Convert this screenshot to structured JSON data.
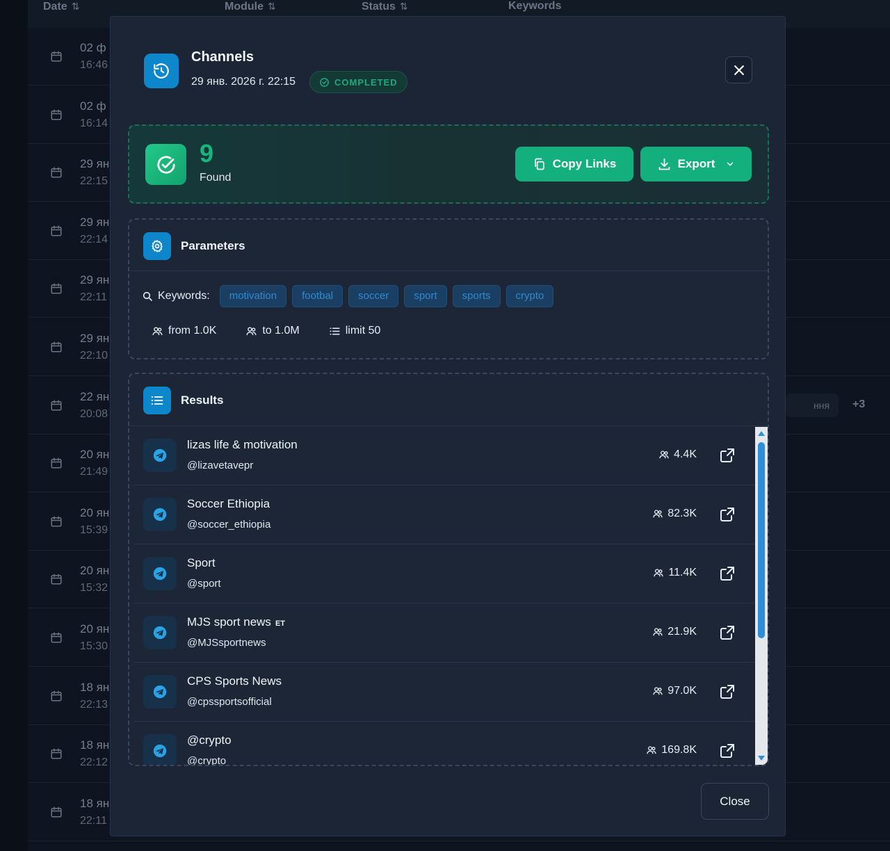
{
  "background": {
    "columns": [
      "Date",
      "Module",
      "Status",
      "Keywords"
    ],
    "rows": [
      {
        "date": "02 ф",
        "time": "16:46"
      },
      {
        "date": "02 ф",
        "time": "16:14"
      },
      {
        "date": "29 ян",
        "time": "22:15"
      },
      {
        "date": "29 ян",
        "time": "22:14"
      },
      {
        "date": "29 ян",
        "time": "22:11"
      },
      {
        "date": "29 ян",
        "time": "22:10"
      },
      {
        "date": "22 ян",
        "time": "20:08"
      },
      {
        "date": "20 ян",
        "time": "21:49"
      },
      {
        "date": "20 ян",
        "time": "15:39"
      },
      {
        "date": "20 ян",
        "time": "15:32"
      },
      {
        "date": "20 ян",
        "time": "15:30"
      },
      {
        "date": "18 ян",
        "time": "22:13"
      },
      {
        "date": "18 ян",
        "time": "22:12"
      },
      {
        "date": "18 ян",
        "time": "22:11"
      }
    ],
    "chip_text": "ння",
    "more_count": "+3"
  },
  "modal": {
    "title": "Channels",
    "date": "29 янв. 2026 г. 22:15",
    "status": "COMPLETED",
    "found": {
      "count": "9",
      "label": "Found"
    },
    "copy_links_label": "Copy Links",
    "export_label": "Export",
    "parameters": {
      "title": "Parameters",
      "keywords_label": "Keywords:",
      "keywords": [
        "motivation",
        "footbal",
        "soccer",
        "sport",
        "sports",
        "crypto"
      ],
      "from": "from 1.0K",
      "to": "to 1.0M",
      "limit": "limit 50"
    },
    "results": {
      "title": "Results",
      "items": [
        {
          "name": "lizas life & motivation",
          "badge": "",
          "handle": "@lizavetavepr",
          "subscribers": "4.4K"
        },
        {
          "name": "Soccer Ethiopia",
          "badge": "",
          "handle": "@soccer_ethiopia",
          "subscribers": "82.3K"
        },
        {
          "name": "Sport",
          "badge": "",
          "handle": "@sport",
          "subscribers": "11.4K"
        },
        {
          "name": "MJS sport news",
          "badge": "ET",
          "handle": "@MJSsportnews",
          "subscribers": "21.9K"
        },
        {
          "name": "CPS Sports News",
          "badge": "",
          "handle": "@cpssportsofficial",
          "subscribers": "97.0K"
        },
        {
          "name": "@crypto",
          "badge": "",
          "handle": "@crypto",
          "subscribers": "169.8K"
        }
      ]
    },
    "close_label": "Close"
  },
  "colors": {
    "accent_blue": "#0e86cc",
    "accent_green": "#13b07d",
    "modal_bg": "#1b2535",
    "page_bg": "#0b0f17"
  }
}
